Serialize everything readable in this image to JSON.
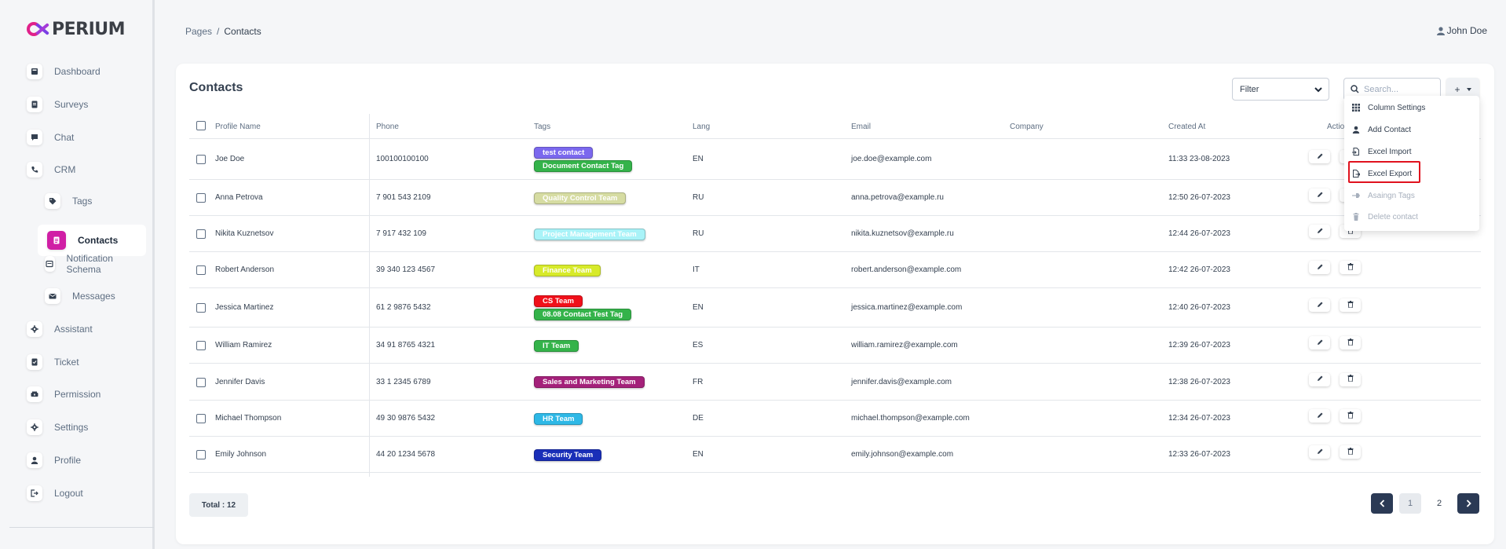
{
  "brand": {
    "logo_text": "PERIUM"
  },
  "breadcrumb": {
    "parent": "Pages",
    "separator": "/",
    "current": "Contacts"
  },
  "user": {
    "name": "John Doe"
  },
  "sidebar": {
    "items": [
      {
        "label": "Dashboard",
        "icon": "dashboard-icon"
      },
      {
        "label": "Surveys",
        "icon": "survey-icon"
      },
      {
        "label": "Chat",
        "icon": "chat-icon"
      },
      {
        "label": "CRM",
        "icon": "phone-icon"
      },
      {
        "label": "Tags",
        "icon": "tag-icon"
      },
      {
        "label": "Contacts",
        "icon": "contacts-icon",
        "active": true
      },
      {
        "label": "Notification Schema",
        "icon": "notification-schema-icon"
      },
      {
        "label": "Messages",
        "icon": "envelope-icon"
      },
      {
        "label": "Assistant",
        "icon": "gear-icon"
      },
      {
        "label": "Ticket",
        "icon": "ticket-icon"
      },
      {
        "label": "Permission",
        "icon": "permission-icon"
      },
      {
        "label": "Settings",
        "icon": "gear-icon"
      },
      {
        "label": "Profile",
        "icon": "user-icon"
      },
      {
        "label": "Logout",
        "icon": "logout-icon"
      }
    ]
  },
  "card": {
    "title": "Contacts",
    "filter_label": "Filter",
    "search_placeholder": "Search...",
    "add_label": "+"
  },
  "table": {
    "columns": [
      "Profile Name",
      "Phone",
      "Tags",
      "Lang",
      "Email",
      "Company",
      "Created At",
      "Actio"
    ],
    "rows": [
      {
        "name": "Joe Doe",
        "phone": "100100100100",
        "tags": [
          {
            "label": "test contact",
            "color": "#7b68ee"
          },
          {
            "label": "Document Contact Tag",
            "color": "#34b34a"
          }
        ],
        "lang": "EN",
        "email": "joe.doe@example.com",
        "company": "",
        "created": "11:33 23-08-2023"
      },
      {
        "name": "Anna Petrova",
        "phone": "7 901 543 2109",
        "tags": [
          {
            "label": "Quality Control Team",
            "color": "#d6dca2"
          }
        ],
        "lang": "RU",
        "email": "anna.petrova@example.ru",
        "company": "",
        "created": "12:50 26-07-2023"
      },
      {
        "name": "Nikita Kuznetsov",
        "phone": "7 917 432 109",
        "tags": [
          {
            "label": "Project Management Team",
            "color": "#a9f3f8"
          }
        ],
        "lang": "RU",
        "email": "nikita.kuznetsov@example.ru",
        "company": "",
        "created": "12:44 26-07-2023"
      },
      {
        "name": "Robert Anderson",
        "phone": "39 340 123 4567",
        "tags": [
          {
            "label": "Finance Team",
            "color": "#d7ea2a"
          }
        ],
        "lang": "IT",
        "email": "robert.anderson@example.com",
        "company": "",
        "created": "12:42 26-07-2023"
      },
      {
        "name": "Jessica Martinez",
        "phone": "61 2 9876 5432",
        "tags": [
          {
            "label": "CS Team",
            "color": "#f0101a"
          },
          {
            "label": "08.08 Contact Test Tag",
            "color": "#34b34a"
          }
        ],
        "lang": "EN",
        "email": "jessica.martinez@example.com",
        "company": "",
        "created": "12:40 26-07-2023"
      },
      {
        "name": "William Ramirez",
        "phone": "34 91 8765 4321",
        "tags": [
          {
            "label": "IT Team",
            "color": "#34b34a"
          }
        ],
        "lang": "ES",
        "email": "william.ramirez@example.com",
        "company": "",
        "created": "12:39 26-07-2023"
      },
      {
        "name": "Jennifer Davis",
        "phone": "33 1 2345 6789",
        "tags": [
          {
            "label": "Sales and Marketing Team",
            "color": "#a4217a"
          }
        ],
        "lang": "FR",
        "email": "jennifer.davis@example.com",
        "company": "",
        "created": "12:38 26-07-2023"
      },
      {
        "name": "Michael Thompson",
        "phone": "49 30 9876 5432",
        "tags": [
          {
            "label": "HR Team",
            "color": "#2eb8e6"
          }
        ],
        "lang": "DE",
        "email": "michael.thompson@example.com",
        "company": "",
        "created": "12:34 26-07-2023"
      },
      {
        "name": "Emily Johnson",
        "phone": "44 20 1234 5678",
        "tags": [
          {
            "label": "Security Team",
            "color": "#1a2fb8"
          }
        ],
        "lang": "EN",
        "email": "emily.johnson@example.com",
        "company": "",
        "created": "12:33 26-07-2023"
      }
    ]
  },
  "footer": {
    "total": "Total : 12",
    "pages": [
      "1",
      "2"
    ],
    "current_page": "1"
  },
  "dropdown": {
    "items": [
      {
        "label": "Column Settings",
        "icon": "grid-icon",
        "disabled": false
      },
      {
        "label": "Add Contact",
        "icon": "user-icon",
        "disabled": false
      },
      {
        "label": "Excel Import",
        "icon": "file-import-icon",
        "disabled": false
      },
      {
        "label": "Excel Export",
        "icon": "file-export-icon",
        "disabled": false,
        "highlighted": true
      },
      {
        "label": "Asaingn Tags",
        "icon": "tag-assign-icon",
        "disabled": true
      },
      {
        "label": "Delete contact",
        "icon": "trash-icon",
        "disabled": true
      }
    ]
  },
  "colors": {
    "accent": "#d01fa5",
    "pager": "#2b3a55",
    "highlight": "#e0121e"
  }
}
